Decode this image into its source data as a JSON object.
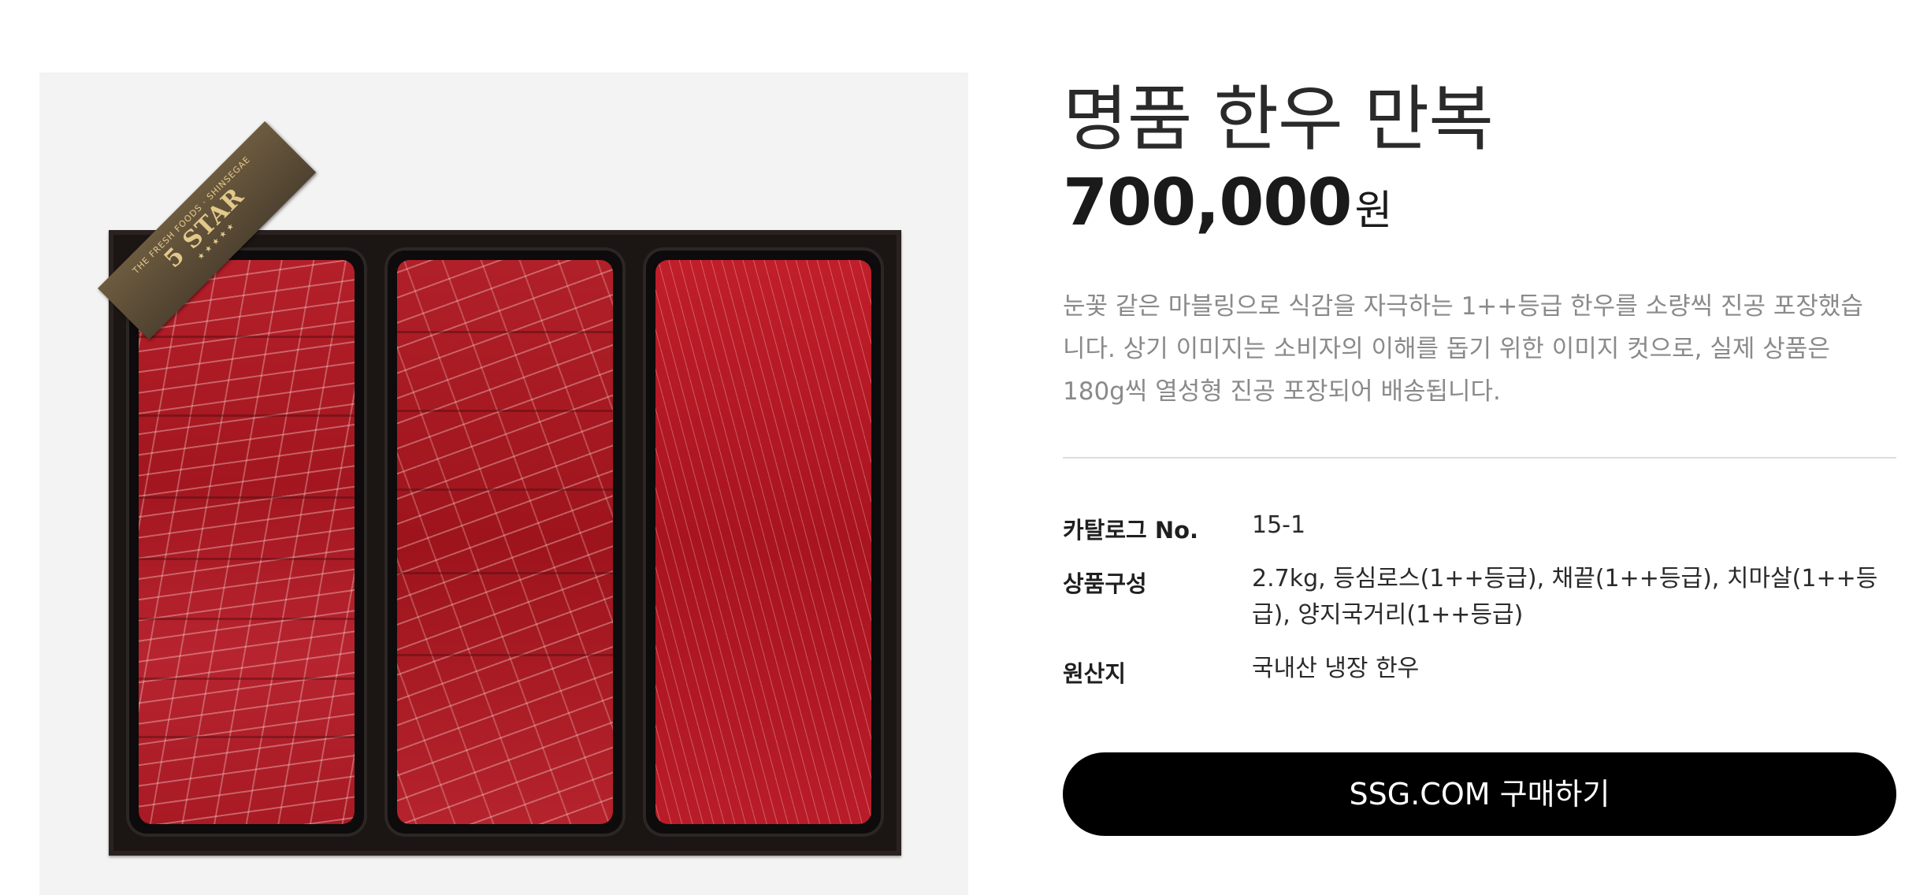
{
  "product": {
    "title": "명품 한우 만복",
    "price_value": "700,000",
    "price_unit": "원",
    "description": "눈꽃 같은 마블링으로 식감을 자극하는 1++등급 한우를 소량씩 진공 포장했습니다. 상기 이미지는 소비자의 이해를 돕기 위한 이미지 컷으로, 실제 상품은 180g씩 열성형 진공 포장되어 배송됩니다.",
    "image": {
      "ribbon_small": "THE FRESH FOODS · SHINSEGAE",
      "ribbon_big": "5 STAR",
      "ribbon_stars": "★★★★★"
    }
  },
  "specs": {
    "catalog": {
      "label": "카탈로그 No.",
      "value": "15-1"
    },
    "composition": {
      "label": "상품구성",
      "value": "2.7kg, 등심로스(1++등급), 채끝(1++등급), 치마살(1++등급), 양지국거리(1++등급)"
    },
    "origin": {
      "label": "원산지",
      "value": "국내산 냉장 한우"
    }
  },
  "actions": {
    "buy_label": "SSG.COM 구매하기"
  },
  "colors": {
    "button_bg": "#000000",
    "button_text": "#ffffff",
    "description_text": "#8a8a8a",
    "image_panel_bg": "#f3f3f3"
  }
}
